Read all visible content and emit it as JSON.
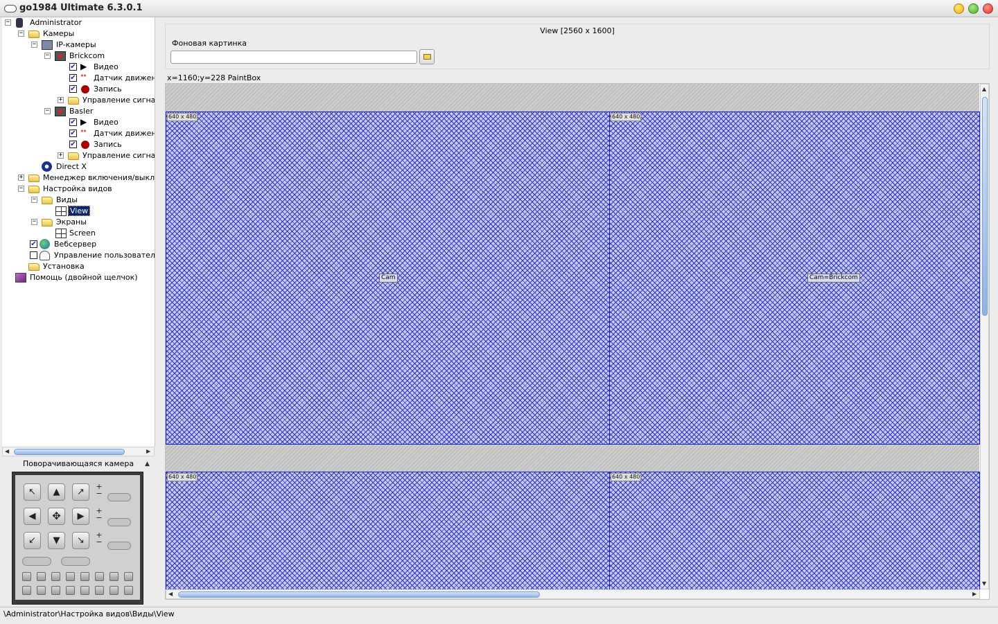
{
  "window": {
    "title": "go1984 Ultimate 6.3.0.1"
  },
  "tree": {
    "administrator": "Administrator",
    "cameras": "Камеры",
    "ip_cameras": "IP-камеры",
    "brickcom": "Brickcom",
    "video1": "Видео",
    "motion1": "Датчик движения",
    "record1": "Запись",
    "signal1": "Управление сигналами",
    "basler": "Basler",
    "video2": "Видео",
    "motion2": "Датчик движения",
    "record2": "Запись",
    "signal2": "Управление сигналами",
    "directx": "Direct X",
    "manager": "Менеджер включения/выключения",
    "view_setup": "Настройка видов",
    "views": "Виды",
    "view": "View",
    "screens": "Экраны",
    "screen": "Screen",
    "webserver": "Вебсервер",
    "user_mgmt": "Управление пользователями",
    "install": "Установка",
    "help": "Помощь (двойной щелчок)"
  },
  "ptz": {
    "title": "Поворачивающаяся камера"
  },
  "main": {
    "view_title": "View [2560 x 1600]",
    "bg_label": "Фоновая картинка",
    "bg_value": "",
    "coords": "x=1160;y=228 PaintBox"
  },
  "cams": {
    "size_a": "640 x 480",
    "size_b": "640 x 480",
    "size_c": "640 x 480",
    "size_d": "640 x 480",
    "label_a": "Cam",
    "label_b": "Cam=Brickcom"
  },
  "statusbar": {
    "path": "\\Administrator\\Настройка видов\\Виды\\View"
  },
  "colors": {
    "minimize": "#f0b400",
    "maximize": "#4caf2a",
    "close": "#e0322a",
    "selection": "#0a246a",
    "cam_fill": "#3235b8"
  }
}
